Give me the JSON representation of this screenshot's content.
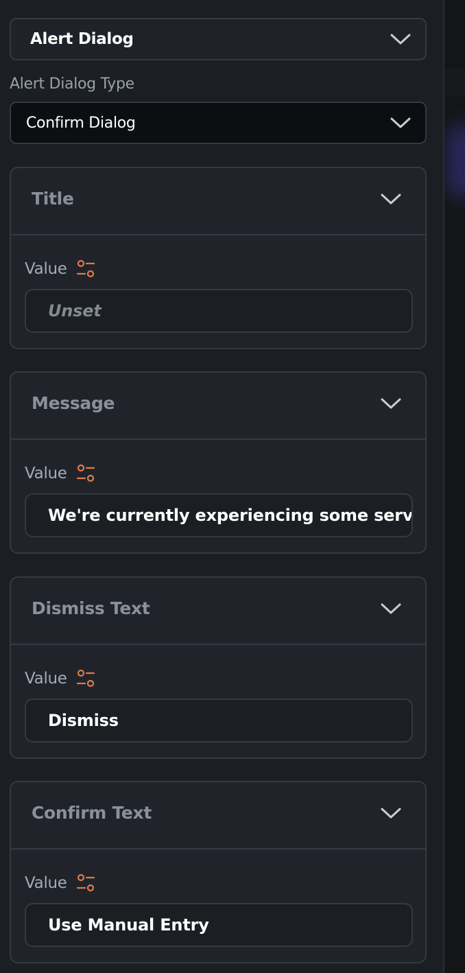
{
  "component_dropdown": {
    "label": "Alert Dialog"
  },
  "alert_dialog_type": {
    "label": "Alert Dialog Type",
    "selected": "Confirm Dialog"
  },
  "sections": [
    {
      "title": "Title",
      "value_label": "Value",
      "value": "Unset",
      "is_unset": true
    },
    {
      "title": "Message",
      "value_label": "Value",
      "value": "We're currently experiencing some serve",
      "is_unset": false
    },
    {
      "title": "Dismiss Text",
      "value_label": "Value",
      "value": "Dismiss",
      "is_unset": false
    },
    {
      "title": "Confirm Text",
      "value_label": "Value",
      "value": "Use Manual Entry",
      "is_unset": false
    }
  ],
  "icons": {
    "chevron": "chevron-down-icon",
    "variable": "variable-binding-icon"
  },
  "colors": {
    "panel_bg": "#1b1e23",
    "section_bg": "#20242a",
    "border": "#353a42",
    "muted_text": "#8a919b",
    "accent_orange": "#e07a4a",
    "sidebar_glow": "#2c2d6a"
  }
}
